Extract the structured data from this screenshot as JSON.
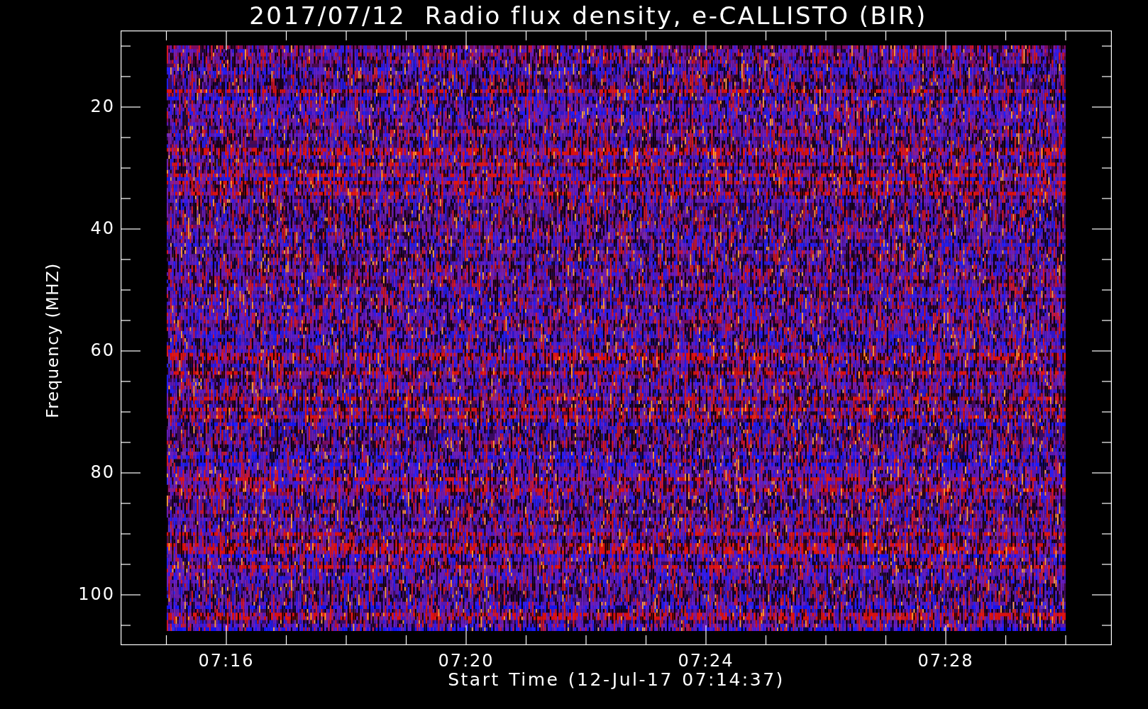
{
  "title": "2017/07/12  Radio flux density, e-CALLISTO (BIR)",
  "y_axis": {
    "label": "Frequency (MHZ)",
    "ticks": [
      "20",
      "40",
      "60",
      "80",
      "100"
    ]
  },
  "x_axis": {
    "label": "Start Time (12-Jul-17 07:14:37)",
    "ticks": [
      "07:16",
      "07:20",
      "07:24",
      "07:28"
    ]
  }
}
